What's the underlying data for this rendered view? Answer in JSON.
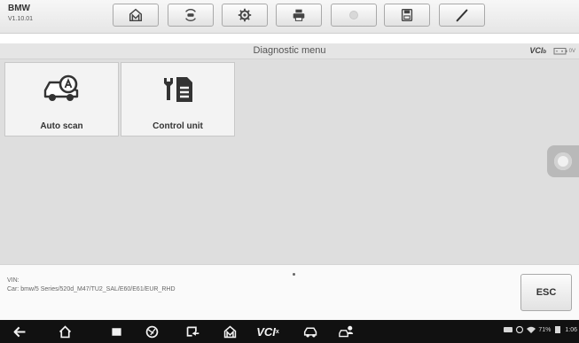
{
  "app": {
    "name": "BMW",
    "version": "V1.10.01"
  },
  "toolbar": [
    {
      "icon": "home-icon",
      "enabled": true
    },
    {
      "icon": "vehicle-swap-icon",
      "enabled": true
    },
    {
      "icon": "settings-gear-icon",
      "enabled": true
    },
    {
      "icon": "printer-icon",
      "enabled": true
    },
    {
      "icon": "help-icon",
      "enabled": false
    },
    {
      "icon": "save-icon",
      "enabled": true
    },
    {
      "icon": "pen-icon",
      "enabled": true
    }
  ],
  "header": {
    "title": "Diagnostic menu",
    "vci_label": "VCI",
    "vci_sub": "b",
    "battery_voltage": "0V"
  },
  "menu": [
    {
      "label": "Auto scan",
      "icon": "car-auto-scan-icon"
    },
    {
      "label": "Control unit",
      "icon": "control-unit-icon"
    }
  ],
  "info": {
    "vin_label": "VIN:",
    "vehicle_label": "Car:",
    "vehicle_path": "bmw/5 Series/520d_M47/TU2_SAL/E60/E61/EUR_RHD",
    "esc_label": "ESC"
  },
  "navbar": {
    "vci_label": "VCI",
    "vci_sub": "x",
    "battery_percent": "71%",
    "clock": "1:06"
  },
  "colors": {
    "work_area_bg": "#dedede",
    "tile_bg": "#f3f3f3",
    "icon_dark": "#333333",
    "navbar_bg": "#111111"
  }
}
